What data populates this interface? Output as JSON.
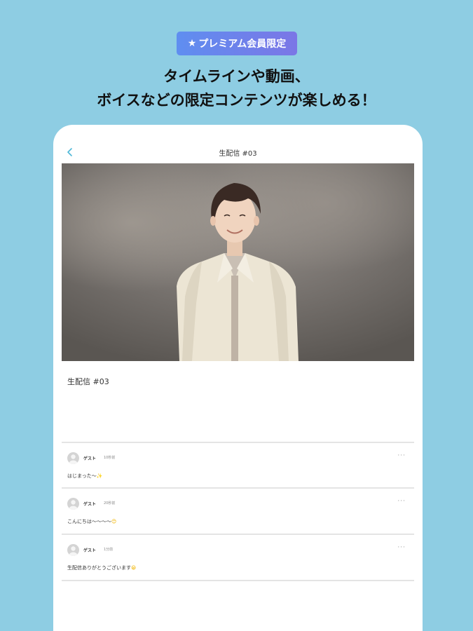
{
  "promo": {
    "badge_star": "★",
    "badge_label": "プレミアム会員限定",
    "headline_line1": "タイムラインや動画、",
    "headline_line2": "ボイスなどの限定コンテンツが楽しめる！"
  },
  "screen": {
    "back_icon": "chevron-left-icon",
    "title": "生配信 #03",
    "post_title": "生配信 #03",
    "comments": [
      {
        "user": "ゲスト",
        "time": "10秒前",
        "text": "はじまった〜",
        "emoji": "✨"
      },
      {
        "user": "ゲスト",
        "time": "20秒前",
        "text": "こんにちは〜〜〜〜",
        "emoji": "😊"
      },
      {
        "user": "ゲスト",
        "time": "1分前",
        "text": "生配信ありがとうございます",
        "emoji": "😀"
      }
    ],
    "more_label": "···"
  },
  "colors": {
    "background": "#8ecde3",
    "badge_gradient_start": "#5f8ef0",
    "badge_gradient_end": "#7b76e6",
    "accent_back": "#4fb8d8"
  }
}
